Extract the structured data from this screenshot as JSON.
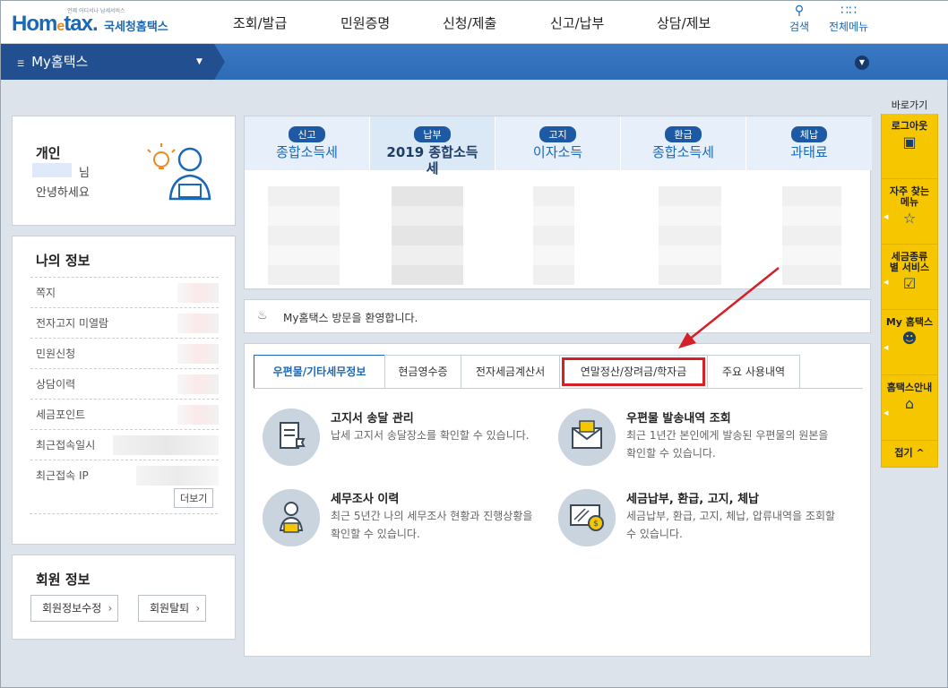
{
  "header": {
    "logo_sub": "언제 어디서나 납세서비스",
    "logo_main": "Hom",
    "logo_e": "e",
    "logo_tax": "tax.",
    "logo_korean": "국세청홈택스",
    "menu": [
      "조회/발급",
      "민원증명",
      "신청/제출",
      "신고/납부",
      "상담/제보"
    ],
    "search_label": "검색",
    "all_menu_label": "전체메뉴"
  },
  "nav": {
    "my_hometax": "My홈택스"
  },
  "greeting": {
    "title": "개인",
    "suffix": "님",
    "text": "안녕하세요"
  },
  "my_info": {
    "title": "나의 정보",
    "rows": [
      "쪽지",
      "전자고지 미열람",
      "민원신청",
      "상담이력",
      "세금포인트",
      "최근접속일시",
      "최근접속 IP"
    ],
    "more": "더보기"
  },
  "member": {
    "title": "회원 정보",
    "edit": "회원정보수정",
    "withdraw": "회원탈퇴"
  },
  "tax_summary": [
    {
      "badge": "신고",
      "name": "종합소득세"
    },
    {
      "badge": "납부",
      "name": "2019 종합소득세"
    },
    {
      "badge": "고지",
      "name": "이자소득"
    },
    {
      "badge": "환급",
      "name": "종합소득세"
    },
    {
      "badge": "체납",
      "name": "과태료"
    }
  ],
  "notice": {
    "text": "My홈택스 방문을 환영합니다."
  },
  "tabs": [
    "우편물/기타세무정보",
    "현금영수증",
    "전자세금계산서",
    "연말정산/장려금/학자금",
    "주요 사용내역"
  ],
  "services": [
    {
      "title": "고지서 송달 관리",
      "desc": "납세 고지서 송달장소를 확인할 수 있습니다."
    },
    {
      "title": "우편물 발송내역 조회",
      "desc": "최근 1년간 본인에게 발송된 우편물의 원본을 확인할 수 있습니다."
    },
    {
      "title": "세무조사 이력",
      "desc": "최근 5년간 나의 세무조사 현황과 진행상황을 확인할 수 있습니다."
    },
    {
      "title": "세금납부, 환급, 고지, 체납",
      "desc": "세금납부, 환급, 고지, 체납, 압류내역을 조회할 수 있습니다."
    }
  ],
  "quick_menu": {
    "label": "바로가기",
    "items": [
      "로그아웃",
      "자주 찾는 메뉴",
      "세금종류별 서비스",
      "My 홈택스",
      "홈택스안내"
    ],
    "fold": "접기 ^"
  },
  "colors": {
    "brand_blue": "#1a68b8",
    "nav_blue": "#2e6bb6",
    "quick_yellow": "#f6c700",
    "highlight_red": "#d62028"
  }
}
